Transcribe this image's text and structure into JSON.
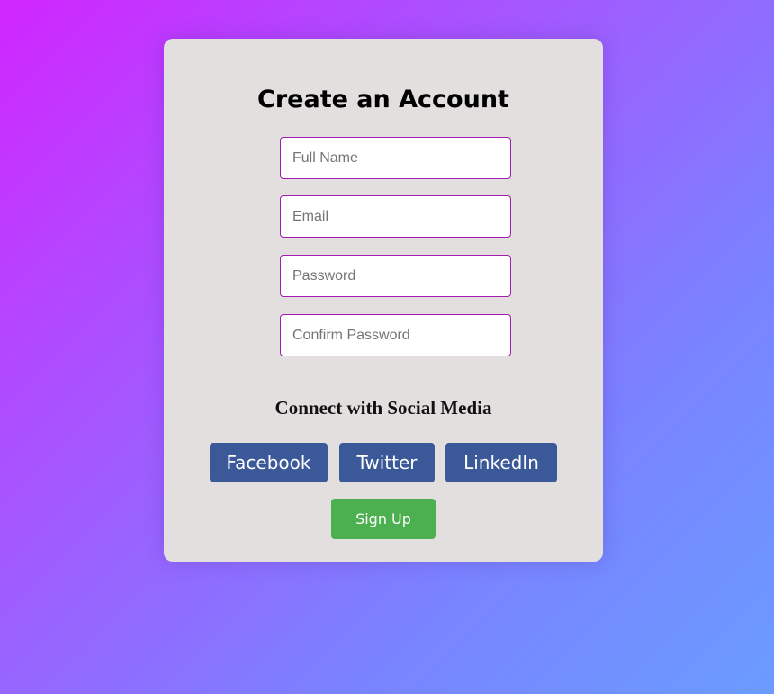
{
  "form": {
    "title": "Create an Account",
    "fields": [
      {
        "placeholder": "Full Name",
        "value": ""
      },
      {
        "placeholder": "Email",
        "value": ""
      },
      {
        "placeholder": "Password",
        "value": ""
      },
      {
        "placeholder": "Confirm Password",
        "value": ""
      }
    ],
    "social_heading": "Connect with Social Media",
    "social_buttons": [
      {
        "label": "Facebook"
      },
      {
        "label": "Twitter"
      },
      {
        "label": "LinkedIn"
      }
    ],
    "submit_label": "Sign Up"
  },
  "colors": {
    "card_background": "#e3dfdf",
    "field_border": "#a21caf",
    "social_button": "#3b5998",
    "submit_button": "#4caf50"
  }
}
